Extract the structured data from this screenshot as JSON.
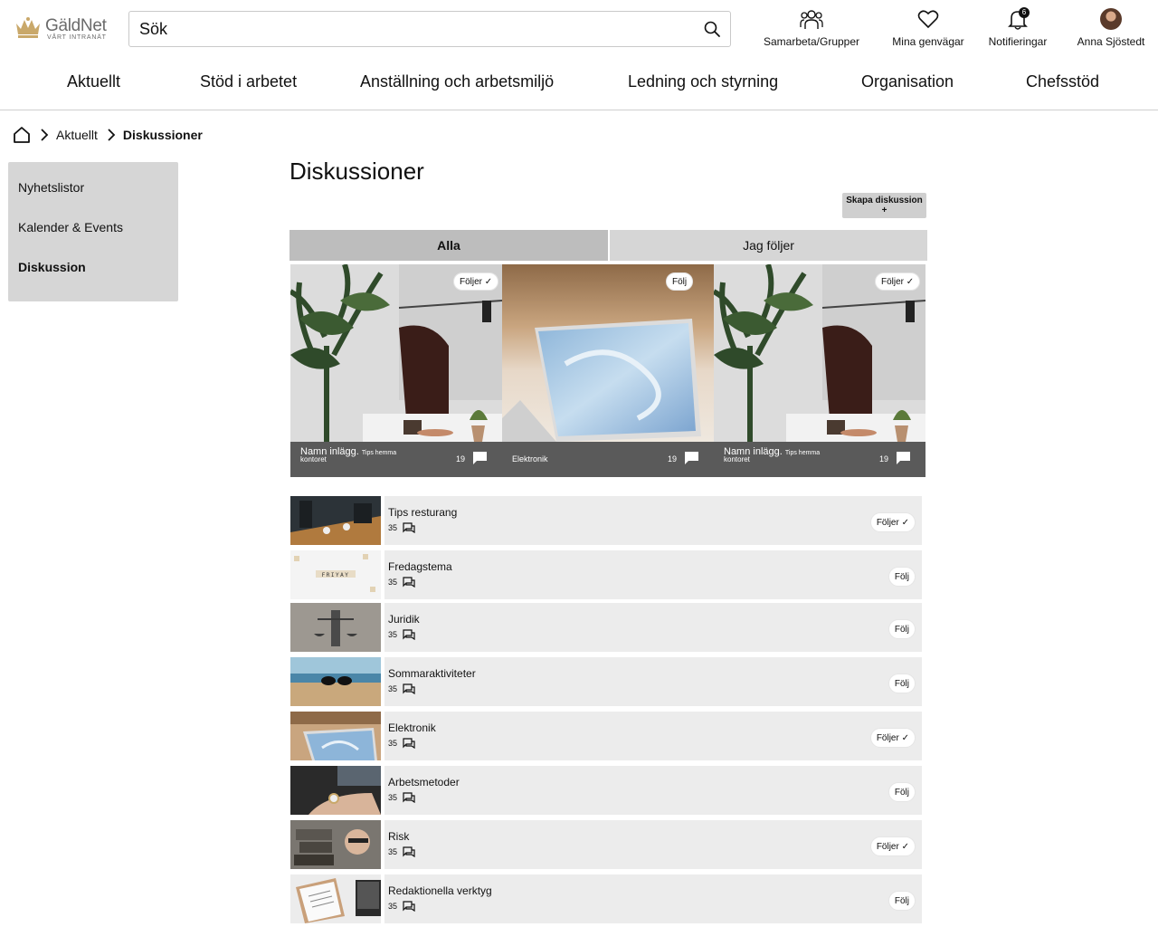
{
  "header": {
    "logo_name": "GäldNet",
    "logo_sub": "VÅRT INTRANÄT",
    "search_placeholder": "Sök",
    "nav": [
      {
        "label": "Samarbeta/Grupper",
        "icon": "group-icon"
      },
      {
        "label": "Mina genvägar",
        "icon": "heart-icon"
      },
      {
        "label": "Notifieringar",
        "icon": "bell-icon",
        "badge": "6"
      },
      {
        "label": "Anna Sjöstedt",
        "icon": "avatar"
      }
    ]
  },
  "mainnav": [
    "Aktuellt",
    "Stöd i arbetet",
    "Anställning och arbetsmiljö",
    "Ledning och styrning",
    "Organisation",
    "Chefsstöd"
  ],
  "breadcrumb": {
    "items": [
      "Aktuellt",
      "Diskussioner"
    ]
  },
  "sidebar": {
    "items": [
      "Nyhetslistor",
      "Kalender & Events",
      "Diskussion"
    ],
    "active_index": 2
  },
  "page": {
    "title": "Diskussioner",
    "create_button": "Skapa diskussion +",
    "tabs": [
      "Alla",
      "Jag följer"
    ]
  },
  "cards": [
    {
      "title": "Namn inlägg.",
      "tag": "Tips hemma",
      "tag2": "kontoret",
      "count": "19",
      "follow": "Följer",
      "following": true,
      "scene": "plant"
    },
    {
      "title": "",
      "tag": "Elektronik",
      "tag2": "",
      "count": "19",
      "follow": "Följ",
      "following": false,
      "scene": "laptop"
    },
    {
      "title": "Namn inlägg.",
      "tag": "Tips hemma",
      "tag2": "kontoret",
      "count": "19",
      "follow": "Följer",
      "following": true,
      "scene": "plant"
    }
  ],
  "rows": [
    {
      "name": "Tips resturang",
      "count": "35",
      "follow": "Följer",
      "following": true,
      "thumb": "restaurant"
    },
    {
      "name": "Fredagstema",
      "count": "35",
      "follow": "Följ",
      "following": false,
      "thumb": "friyay"
    },
    {
      "name": "Juridik",
      "count": "35",
      "follow": "Följ",
      "following": false,
      "thumb": "justice"
    },
    {
      "name": "Sommaraktiviteter",
      "count": "35",
      "follow": "Följ",
      "following": false,
      "thumb": "beach"
    },
    {
      "name": "Elektronik",
      "count": "35",
      "follow": "Följer",
      "following": true,
      "thumb": "laptop"
    },
    {
      "name": "Arbetsmetoder",
      "count": "35",
      "follow": "Följ",
      "following": false,
      "thumb": "watch"
    },
    {
      "name": "Risk",
      "count": "35",
      "follow": "Följer",
      "following": true,
      "thumb": "risk"
    },
    {
      "name": "Redaktionella verktyg",
      "count": "35",
      "follow": "Följ",
      "following": false,
      "thumb": "clipboard"
    }
  ],
  "colors": {
    "accent": "#c9a86a",
    "bar": "#5a5a5a",
    "tab_active": "#bdbdbd",
    "tab_inactive": "#d6d6d6",
    "row_bg": "#ececec"
  }
}
